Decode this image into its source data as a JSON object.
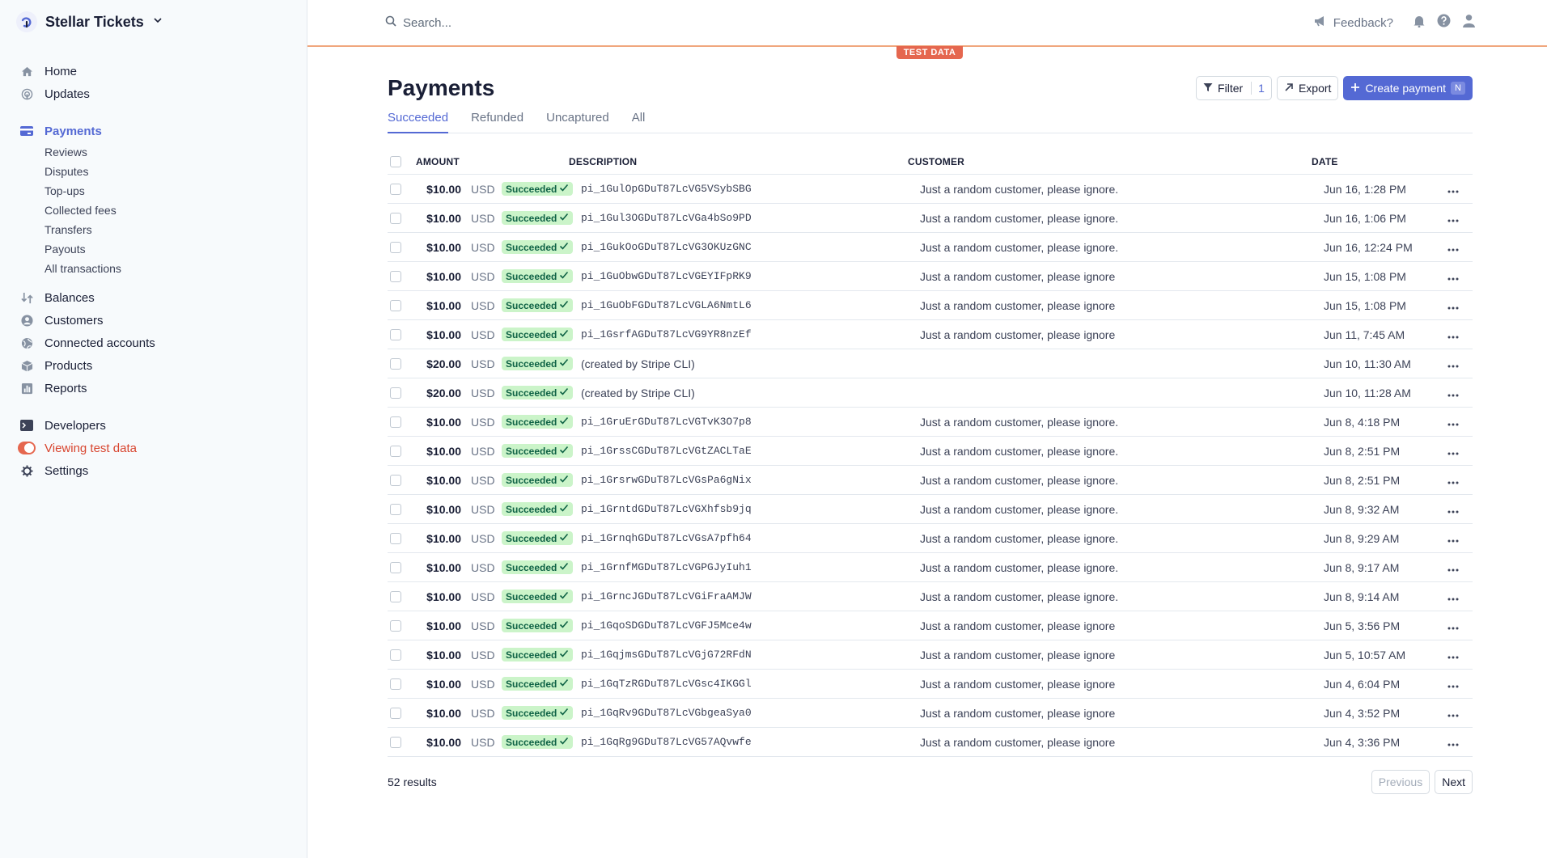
{
  "account": {
    "name": "Stellar Tickets"
  },
  "nav": {
    "home": "Home",
    "updates": "Updates",
    "payments": "Payments",
    "payments_sub": [
      "Reviews",
      "Disputes",
      "Top-ups",
      "Collected fees",
      "Transfers",
      "Payouts",
      "All transactions"
    ],
    "balances": "Balances",
    "customers": "Customers",
    "connected_accounts": "Connected accounts",
    "products": "Products",
    "reports": "Reports",
    "developers": "Developers",
    "viewing_test_data": "Viewing test data",
    "settings": "Settings"
  },
  "topbar": {
    "search_placeholder": "Search...",
    "feedback": "Feedback?",
    "test_badge": "TEST DATA"
  },
  "page": {
    "title": "Payments",
    "filter_label": "Filter",
    "filter_count": "1",
    "export_label": "Export",
    "create_label": "Create payment",
    "create_shortcut": "N",
    "tabs": [
      "Succeeded",
      "Refunded",
      "Uncaptured",
      "All"
    ],
    "columns": {
      "amount": "AMOUNT",
      "description": "DESCRIPTION",
      "customer": "CUSTOMER",
      "date": "DATE"
    },
    "results": "52 results",
    "previous": "Previous",
    "next": "Next"
  },
  "rows": [
    {
      "amount": "$10.00",
      "currency": "USD",
      "status": "Succeeded",
      "description": "pi_1GulOpGDuT87LcVG5VSybSBG",
      "customer": "Just a random customer, please ignore.",
      "date": "Jun 16, 1:28 PM"
    },
    {
      "amount": "$10.00",
      "currency": "USD",
      "status": "Succeeded",
      "description": "pi_1Gul3OGDuT87LcVGa4bSo9PD",
      "customer": "Just a random customer, please ignore.",
      "date": "Jun 16, 1:06 PM"
    },
    {
      "amount": "$10.00",
      "currency": "USD",
      "status": "Succeeded",
      "description": "pi_1GukOoGDuT87LcVG3OKUzGNC",
      "customer": "Just a random customer, please ignore.",
      "date": "Jun 16, 12:24 PM"
    },
    {
      "amount": "$10.00",
      "currency": "USD",
      "status": "Succeeded",
      "description": "pi_1GuObwGDuT87LcVGEYIFpRK9",
      "customer": "Just a random customer, please ignore",
      "date": "Jun 15, 1:08 PM"
    },
    {
      "amount": "$10.00",
      "currency": "USD",
      "status": "Succeeded",
      "description": "pi_1GuObFGDuT87LcVGLA6NmtL6",
      "customer": "Just a random customer, please ignore",
      "date": "Jun 15, 1:08 PM"
    },
    {
      "amount": "$10.00",
      "currency": "USD",
      "status": "Succeeded",
      "description": "pi_1GsrfAGDuT87LcVG9YR8nzEf",
      "customer": "Just a random customer, please ignore",
      "date": "Jun 11, 7:45 AM"
    },
    {
      "amount": "$20.00",
      "currency": "USD",
      "status": "Succeeded",
      "description": "(created by Stripe CLI)",
      "customer": "",
      "date": "Jun 10, 11:30 AM"
    },
    {
      "amount": "$20.00",
      "currency": "USD",
      "status": "Succeeded",
      "description": "(created by Stripe CLI)",
      "customer": "",
      "date": "Jun 10, 11:28 AM"
    },
    {
      "amount": "$10.00",
      "currency": "USD",
      "status": "Succeeded",
      "description": "pi_1GruErGDuT87LcVGTvK3O7p8",
      "customer": "Just a random customer, please ignore.",
      "date": "Jun 8, 4:18 PM"
    },
    {
      "amount": "$10.00",
      "currency": "USD",
      "status": "Succeeded",
      "description": "pi_1GrssCGDuT87LcVGtZACLTaE",
      "customer": "Just a random customer, please ignore.",
      "date": "Jun 8, 2:51 PM"
    },
    {
      "amount": "$10.00",
      "currency": "USD",
      "status": "Succeeded",
      "description": "pi_1GrsrwGDuT87LcVGsPa6gNix",
      "customer": "Just a random customer, please ignore.",
      "date": "Jun 8, 2:51 PM"
    },
    {
      "amount": "$10.00",
      "currency": "USD",
      "status": "Succeeded",
      "description": "pi_1GrntdGDuT87LcVGXhfsb9jq",
      "customer": "Just a random customer, please ignore.",
      "date": "Jun 8, 9:32 AM"
    },
    {
      "amount": "$10.00",
      "currency": "USD",
      "status": "Succeeded",
      "description": "pi_1GrnqhGDuT87LcVGsA7pfh64",
      "customer": "Just a random customer, please ignore.",
      "date": "Jun 8, 9:29 AM"
    },
    {
      "amount": "$10.00",
      "currency": "USD",
      "status": "Succeeded",
      "description": "pi_1GrnfMGDuT87LcVGPGJyIuh1",
      "customer": "Just a random customer, please ignore.",
      "date": "Jun 8, 9:17 AM"
    },
    {
      "amount": "$10.00",
      "currency": "USD",
      "status": "Succeeded",
      "description": "pi_1GrncJGDuT87LcVGiFraAMJW",
      "customer": "Just a random customer, please ignore.",
      "date": "Jun 8, 9:14 AM"
    },
    {
      "amount": "$10.00",
      "currency": "USD",
      "status": "Succeeded",
      "description": "pi_1GqoSDGDuT87LcVGFJ5Mce4w",
      "customer": "Just a random customer, please ignore",
      "date": "Jun 5, 3:56 PM"
    },
    {
      "amount": "$10.00",
      "currency": "USD",
      "status": "Succeeded",
      "description": "pi_1GqjmsGDuT87LcVGjG72RFdN",
      "customer": "Just a random customer, please ignore",
      "date": "Jun 5, 10:57 AM"
    },
    {
      "amount": "$10.00",
      "currency": "USD",
      "status": "Succeeded",
      "description": "pi_1GqTzRGDuT87LcVGsc4IKGGl",
      "customer": "Just a random customer, please ignore",
      "date": "Jun 4, 6:04 PM"
    },
    {
      "amount": "$10.00",
      "currency": "USD",
      "status": "Succeeded",
      "description": "pi_1GqRv9GDuT87LcVGbgeaSya0",
      "customer": "Just a random customer, please ignore",
      "date": "Jun 4, 3:52 PM"
    },
    {
      "amount": "$10.00",
      "currency": "USD",
      "status": "Succeeded",
      "description": "pi_1GqRg9GDuT87LcVG57AQvwfe",
      "customer": "Just a random customer, please ignore",
      "date": "Jun 4, 3:36 PM"
    }
  ],
  "colors": {
    "accent": "#5469d4",
    "test_mode": "#e5674f",
    "success_bg": "#cbf4c9",
    "success_text": "#0e6245"
  }
}
